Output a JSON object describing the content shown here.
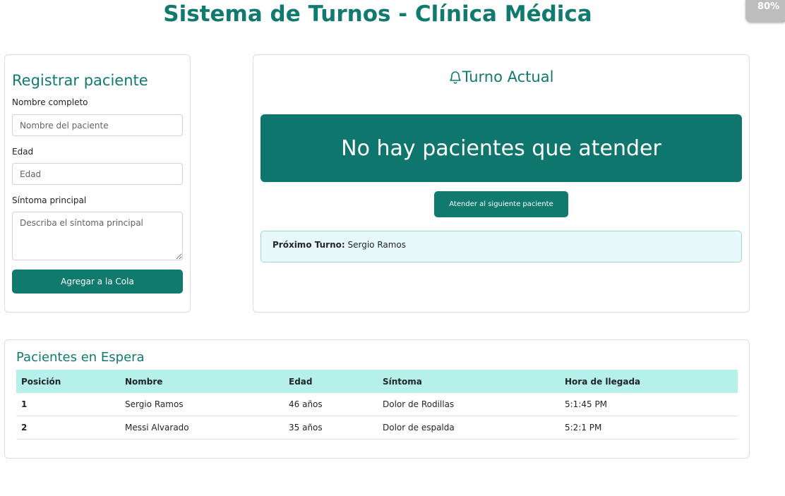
{
  "header": {
    "title": "Sistema de Turnos - Clínica Médica"
  },
  "zoom": "80%",
  "register": {
    "title": "Registrar paciente",
    "name_label": "Nombre completo",
    "name_placeholder": "Nombre del paciente",
    "age_label": "Edad",
    "age_placeholder": "Edad",
    "symptom_label": "Síntoma principal",
    "symptom_placeholder": "Describa el síntoma principal",
    "submit_label": "Agregar a la Cola"
  },
  "current": {
    "title": "Turno Actual",
    "title_icon": "bell-icon",
    "status": "No hay pacientes que atender",
    "next_button_label": "Atender al siguiente paciente",
    "next_turn_label": "Próximo Turno:",
    "next_turn_name": "Sergio Ramos"
  },
  "waiting": {
    "title": "Pacientes en Espera",
    "columns": [
      "Posición",
      "Nombre",
      "Edad",
      "Síntoma",
      "Hora de llegada"
    ],
    "rows": [
      {
        "position": "1",
        "name": "Sergio Ramos",
        "age": "46 años",
        "symptom": "Dolor de Rodillas",
        "arrival": "5:1:45 PM"
      },
      {
        "position": "2",
        "name": "Messi Alvarado",
        "age": "35 años",
        "symptom": "Dolor de espalda",
        "arrival": "5:2:1 PM"
      }
    ]
  },
  "colors": {
    "primary": "#117a6f",
    "banner": "#0f766d",
    "table_header": "#b6f0ea",
    "next_box_bg": "#e8f9f9"
  }
}
